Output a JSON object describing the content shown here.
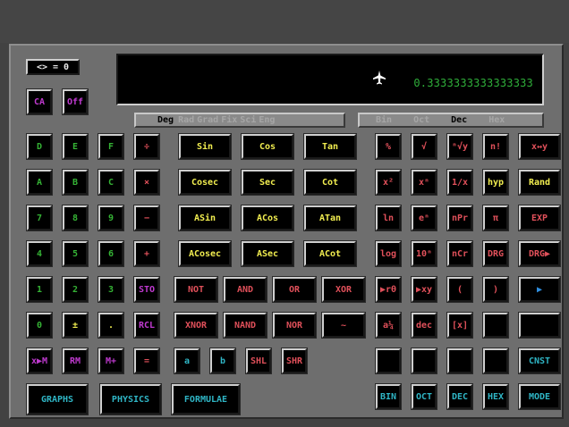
{
  "memory_indicator": "<> = 0",
  "display": {
    "value": "0.3333333333333333"
  },
  "angle_modes": [
    "Deg",
    "Rad",
    "Grad",
    "Fix",
    "Sci",
    "Eng"
  ],
  "base_modes": [
    "Bin",
    "Oct",
    "Dec",
    "Hex"
  ],
  "keys": {
    "ca": "CA",
    "off": "Off",
    "hexD": "D",
    "hexE": "E",
    "hexF": "F",
    "hexA": "A",
    "hexB": "B",
    "hexC": "C",
    "n7": "7",
    "n8": "8",
    "n9": "9",
    "n4": "4",
    "n5": "5",
    "n6": "6",
    "n1": "1",
    "n2": "2",
    "n3": "3",
    "n0": "0",
    "pm": "±",
    "dot": ".",
    "div": "÷",
    "mul": "×",
    "minus": "−",
    "plus": "+",
    "sto": "STO",
    "rcl": "RCL",
    "equals": "=",
    "xm": "x▶M",
    "rm": "RM",
    "mplus": "M+",
    "sin": "Sin",
    "cos": "Cos",
    "tan": "Tan",
    "cosec": "Cosec",
    "sec": "Sec",
    "cot": "Cot",
    "asin": "ASin",
    "acos": "ACos",
    "atan": "ATan",
    "acosec": "ACosec",
    "asec": "ASec",
    "acot": "ACot",
    "not": "NOT",
    "and": "AND",
    "or": "OR",
    "xor": "XOR",
    "xnor": "XNOR",
    "nand": "NAND",
    "nor": "NOR",
    "tilde": "~",
    "a": "a",
    "b": "b",
    "shl": "SHL",
    "shr": "SHR",
    "percent": "%",
    "sqrt": "√",
    "nroot": "ⁿ√y",
    "nfact": "n!",
    "swap": "x↔y",
    "x2": "x²",
    "xn": "xⁿ",
    "inv": "1/x",
    "hyp": "hyp",
    "rand": "Rand",
    "ln": "ln",
    "en": "eⁿ",
    "npr": "nPr",
    "pi": "π",
    "exp": "EXP",
    "log": "log",
    "ten": "10ⁿ",
    "ncr": "nCr",
    "drg": "DRG",
    "drgp": "DRG▶",
    "rtheta": "▶rθ",
    "xy": "▶xy",
    "lparen": "(",
    "rparen": ")",
    "play": "▶",
    "frac": "a¼",
    "dec": "dec",
    "bracketx": "[x]",
    "cnst": "CNST",
    "bin": "BIN",
    "oct": "OCT",
    "decb": "DEC",
    "hex": "HEX",
    "mode": "MODE",
    "graphs": "GRAPHS",
    "physics": "PHYSICS",
    "formulae": "FORMULAE"
  },
  "colors": {
    "green": "#35b335",
    "red": "#e0505a",
    "yellow": "#f2ee50",
    "magenta": "#c03ad0",
    "cyan": "#2fb5c5",
    "display_text": "#2fae3a"
  }
}
